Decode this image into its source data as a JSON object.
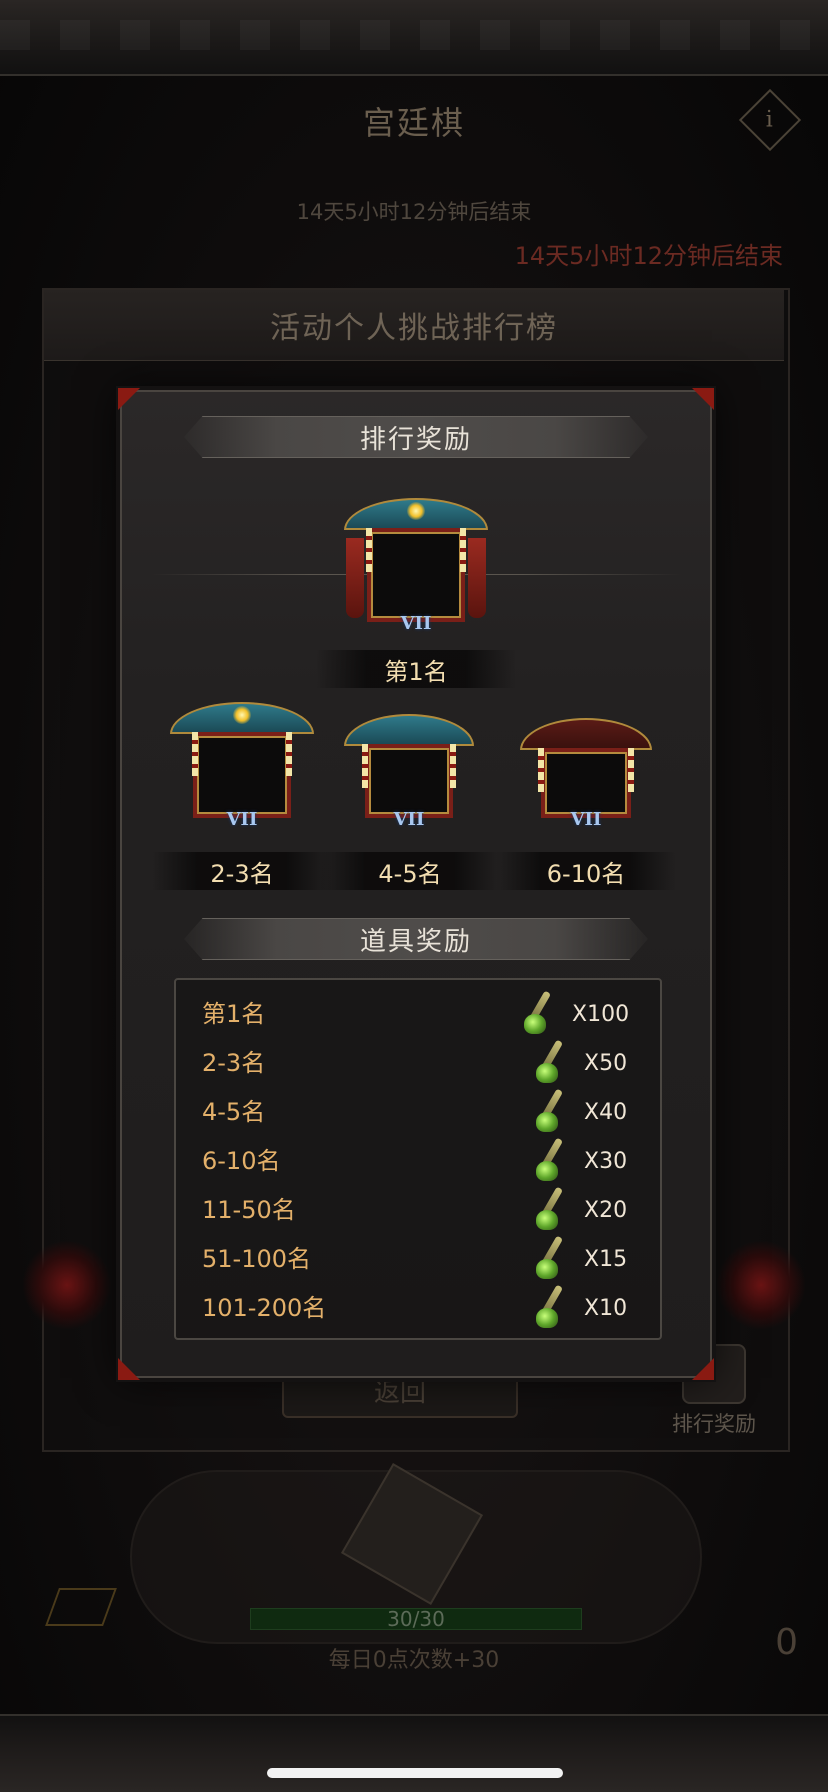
{
  "background": {
    "game_title": "宫廷棋",
    "countdown": "14天5小时12分钟后结束",
    "countdown_alert": "14天5小时12分钟后结束",
    "panel_title": "活动个人挑战排行榜",
    "return_button": "返回",
    "rank_reward_button": "排行奖励",
    "progress": "30/30",
    "daily_note": "每日0点次数+30",
    "dice_count": "0"
  },
  "modal": {
    "section_rank_reward": "排行奖励",
    "section_item_reward": "道具奖励",
    "frames": [
      {
        "label": "第1名",
        "emblem": "VII",
        "style": "grand"
      },
      {
        "label": "2-3名",
        "emblem": "VII",
        "style": "ornate"
      },
      {
        "label": "4-5名",
        "emblem": "VII",
        "style": "standard"
      },
      {
        "label": "6-10名",
        "emblem": "VII",
        "style": "plain"
      }
    ],
    "items": [
      {
        "rank": "第1名",
        "qty": "X100",
        "icon": "green-orb-staff-icon"
      },
      {
        "rank": "2-3名",
        "qty": "X50",
        "icon": "green-orb-staff-icon"
      },
      {
        "rank": "4-5名",
        "qty": "X40",
        "icon": "green-orb-staff-icon"
      },
      {
        "rank": "6-10名",
        "qty": "X30",
        "icon": "green-orb-staff-icon"
      },
      {
        "rank": "11-50名",
        "qty": "X20",
        "icon": "green-orb-staff-icon"
      },
      {
        "rank": "51-100名",
        "qty": "X15",
        "icon": "green-orb-staff-icon"
      },
      {
        "rank": "101-200名",
        "qty": "X10",
        "icon": "green-orb-staff-icon"
      }
    ]
  },
  "colors": {
    "accent_gold": "#e3b06a",
    "corner_red": "#8a1a12",
    "alert_red": "#6b2a22"
  }
}
